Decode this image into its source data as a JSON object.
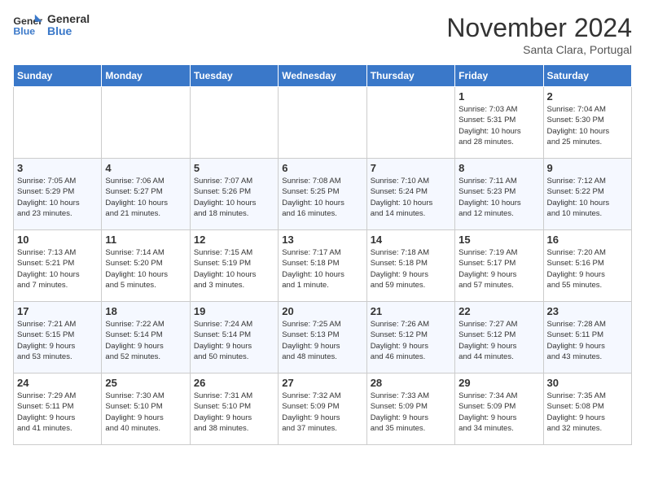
{
  "header": {
    "logo_line1": "General",
    "logo_line2": "Blue",
    "month": "November 2024",
    "location": "Santa Clara, Portugal"
  },
  "weekdays": [
    "Sunday",
    "Monday",
    "Tuesday",
    "Wednesday",
    "Thursday",
    "Friday",
    "Saturday"
  ],
  "weeks": [
    [
      {
        "day": "",
        "info": ""
      },
      {
        "day": "",
        "info": ""
      },
      {
        "day": "",
        "info": ""
      },
      {
        "day": "",
        "info": ""
      },
      {
        "day": "",
        "info": ""
      },
      {
        "day": "1",
        "info": "Sunrise: 7:03 AM\nSunset: 5:31 PM\nDaylight: 10 hours\nand 28 minutes."
      },
      {
        "day": "2",
        "info": "Sunrise: 7:04 AM\nSunset: 5:30 PM\nDaylight: 10 hours\nand 25 minutes."
      }
    ],
    [
      {
        "day": "3",
        "info": "Sunrise: 7:05 AM\nSunset: 5:29 PM\nDaylight: 10 hours\nand 23 minutes."
      },
      {
        "day": "4",
        "info": "Sunrise: 7:06 AM\nSunset: 5:27 PM\nDaylight: 10 hours\nand 21 minutes."
      },
      {
        "day": "5",
        "info": "Sunrise: 7:07 AM\nSunset: 5:26 PM\nDaylight: 10 hours\nand 18 minutes."
      },
      {
        "day": "6",
        "info": "Sunrise: 7:08 AM\nSunset: 5:25 PM\nDaylight: 10 hours\nand 16 minutes."
      },
      {
        "day": "7",
        "info": "Sunrise: 7:10 AM\nSunset: 5:24 PM\nDaylight: 10 hours\nand 14 minutes."
      },
      {
        "day": "8",
        "info": "Sunrise: 7:11 AM\nSunset: 5:23 PM\nDaylight: 10 hours\nand 12 minutes."
      },
      {
        "day": "9",
        "info": "Sunrise: 7:12 AM\nSunset: 5:22 PM\nDaylight: 10 hours\nand 10 minutes."
      }
    ],
    [
      {
        "day": "10",
        "info": "Sunrise: 7:13 AM\nSunset: 5:21 PM\nDaylight: 10 hours\nand 7 minutes."
      },
      {
        "day": "11",
        "info": "Sunrise: 7:14 AM\nSunset: 5:20 PM\nDaylight: 10 hours\nand 5 minutes."
      },
      {
        "day": "12",
        "info": "Sunrise: 7:15 AM\nSunset: 5:19 PM\nDaylight: 10 hours\nand 3 minutes."
      },
      {
        "day": "13",
        "info": "Sunrise: 7:17 AM\nSunset: 5:18 PM\nDaylight: 10 hours\nand 1 minute."
      },
      {
        "day": "14",
        "info": "Sunrise: 7:18 AM\nSunset: 5:18 PM\nDaylight: 9 hours\nand 59 minutes."
      },
      {
        "day": "15",
        "info": "Sunrise: 7:19 AM\nSunset: 5:17 PM\nDaylight: 9 hours\nand 57 minutes."
      },
      {
        "day": "16",
        "info": "Sunrise: 7:20 AM\nSunset: 5:16 PM\nDaylight: 9 hours\nand 55 minutes."
      }
    ],
    [
      {
        "day": "17",
        "info": "Sunrise: 7:21 AM\nSunset: 5:15 PM\nDaylight: 9 hours\nand 53 minutes."
      },
      {
        "day": "18",
        "info": "Sunrise: 7:22 AM\nSunset: 5:14 PM\nDaylight: 9 hours\nand 52 minutes."
      },
      {
        "day": "19",
        "info": "Sunrise: 7:24 AM\nSunset: 5:14 PM\nDaylight: 9 hours\nand 50 minutes."
      },
      {
        "day": "20",
        "info": "Sunrise: 7:25 AM\nSunset: 5:13 PM\nDaylight: 9 hours\nand 48 minutes."
      },
      {
        "day": "21",
        "info": "Sunrise: 7:26 AM\nSunset: 5:12 PM\nDaylight: 9 hours\nand 46 minutes."
      },
      {
        "day": "22",
        "info": "Sunrise: 7:27 AM\nSunset: 5:12 PM\nDaylight: 9 hours\nand 44 minutes."
      },
      {
        "day": "23",
        "info": "Sunrise: 7:28 AM\nSunset: 5:11 PM\nDaylight: 9 hours\nand 43 minutes."
      }
    ],
    [
      {
        "day": "24",
        "info": "Sunrise: 7:29 AM\nSunset: 5:11 PM\nDaylight: 9 hours\nand 41 minutes."
      },
      {
        "day": "25",
        "info": "Sunrise: 7:30 AM\nSunset: 5:10 PM\nDaylight: 9 hours\nand 40 minutes."
      },
      {
        "day": "26",
        "info": "Sunrise: 7:31 AM\nSunset: 5:10 PM\nDaylight: 9 hours\nand 38 minutes."
      },
      {
        "day": "27",
        "info": "Sunrise: 7:32 AM\nSunset: 5:09 PM\nDaylight: 9 hours\nand 37 minutes."
      },
      {
        "day": "28",
        "info": "Sunrise: 7:33 AM\nSunset: 5:09 PM\nDaylight: 9 hours\nand 35 minutes."
      },
      {
        "day": "29",
        "info": "Sunrise: 7:34 AM\nSunset: 5:09 PM\nDaylight: 9 hours\nand 34 minutes."
      },
      {
        "day": "30",
        "info": "Sunrise: 7:35 AM\nSunset: 5:08 PM\nDaylight: 9 hours\nand 32 minutes."
      }
    ]
  ]
}
